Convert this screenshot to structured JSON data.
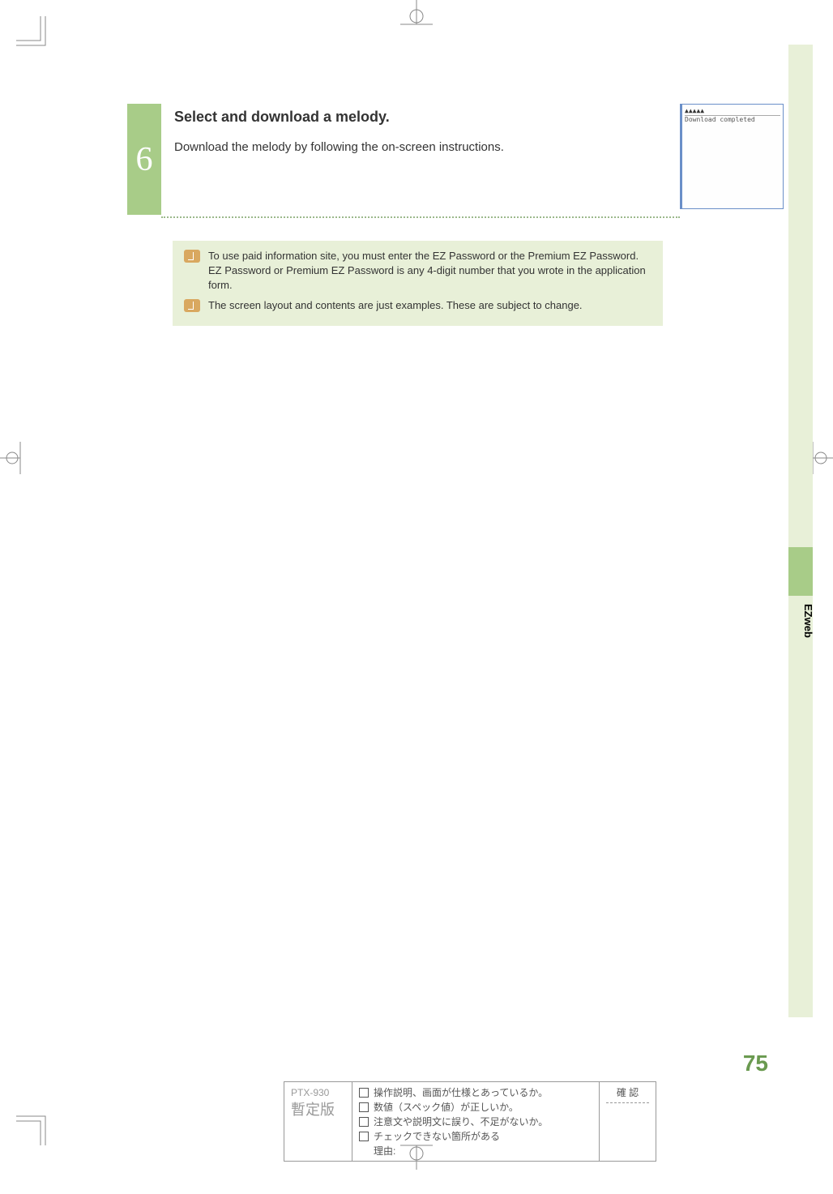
{
  "page_number": "75",
  "side_label": "EZweb",
  "step": {
    "number": "6",
    "title": "Select and download a melody.",
    "description": "Download the melody by following the on-screen instructions."
  },
  "phone_screen": {
    "header": "▲▲▲▲▲",
    "message": "Download completed"
  },
  "notes": [
    "To use paid information site, you must enter the EZ Password or the Premium EZ Password. EZ Password or Premium EZ Password is any 4-digit number that you wrote in the application form.",
    "The screen layout and contents are just examples. These are subject to change."
  ],
  "check_area": {
    "model": "PTX-930",
    "version": "暫定版",
    "confirm_label": "確 認",
    "items": [
      "操作説明、画面が仕様とあっているか。",
      "数値（スペック値）が正しいか。",
      "注意文や説明文に誤り、不足がないか。",
      "チェックできない箇所がある"
    ],
    "reason_label": "理由:"
  }
}
